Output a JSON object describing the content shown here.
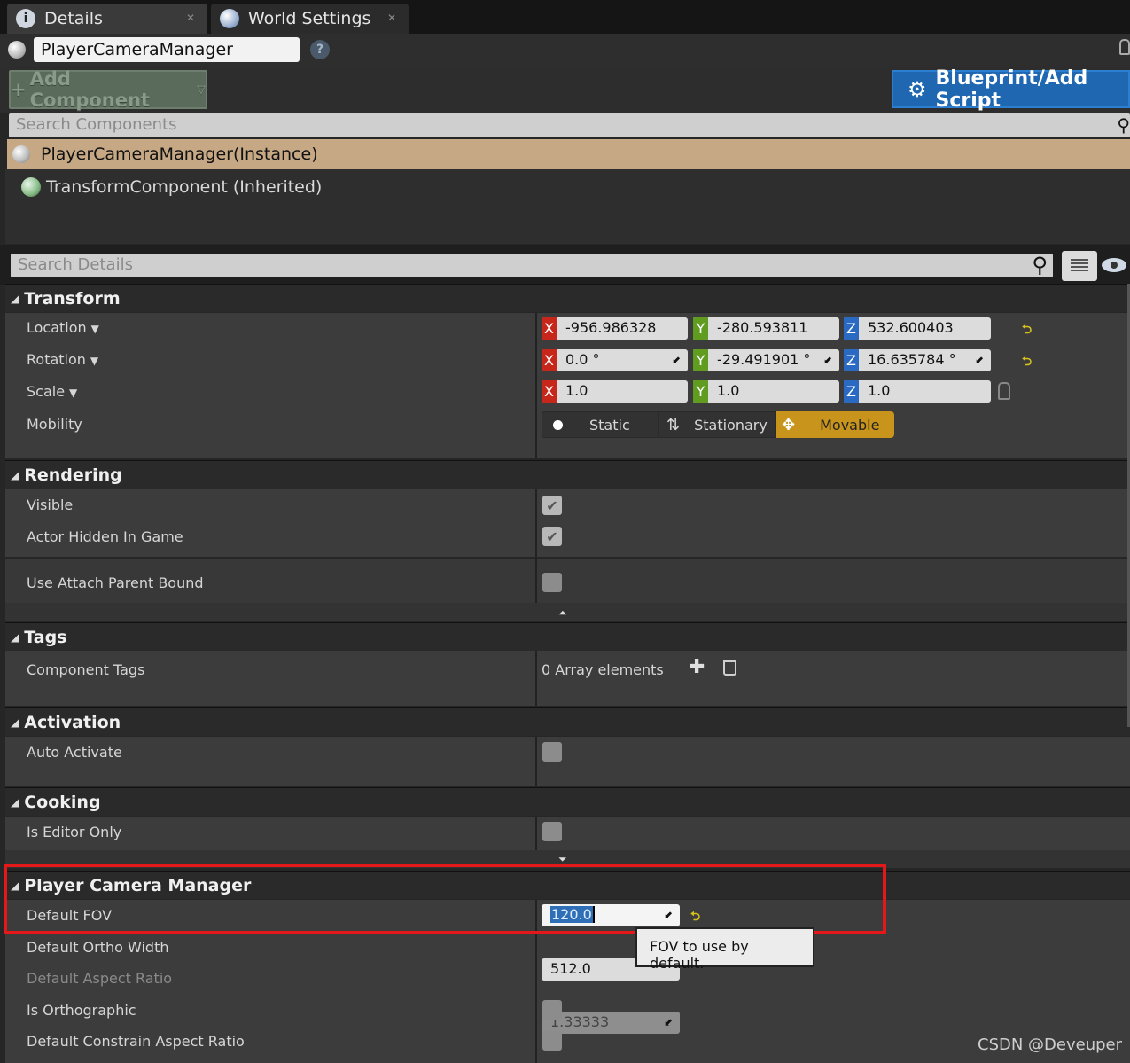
{
  "tabs": [
    {
      "label": "Details",
      "icon": "info-icon",
      "close": "✕"
    },
    {
      "label": "World Settings",
      "icon": "globe-icon",
      "close": "✕"
    }
  ],
  "actor_name": "PlayerCameraManager",
  "help_glyph": "?",
  "add_component_label": "Add Component",
  "blueprint_label": "Blueprint/Add Script",
  "search_components_placeholder": "Search Components",
  "components": {
    "selected": "PlayerCameraManager(Instance)",
    "child": "TransformComponent (Inherited)"
  },
  "search_details_placeholder": "Search Details",
  "categories": {
    "transform": "Transform",
    "rendering": "Rendering",
    "tags": "Tags",
    "activation": "Activation",
    "cooking": "Cooking",
    "pcm": "Player Camera Manager"
  },
  "transform": {
    "location_label": "Location",
    "rotation_label": "Rotation",
    "scale_label": "Scale",
    "mobility_label": "Mobility",
    "axis": {
      "x": "X",
      "y": "Y",
      "z": "Z"
    },
    "location": {
      "x": "-956.986328",
      "y": "-280.593811",
      "z": "532.600403"
    },
    "rotation": {
      "x": "0.0 °",
      "y": "-29.491901 °",
      "z": "16.635784 °"
    },
    "scale": {
      "x": "1.0",
      "y": "1.0",
      "z": "1.0"
    },
    "mobility_options": {
      "static": "Static",
      "stationary": "Stationary",
      "movable": "Movable"
    },
    "mobility_selected": "Movable"
  },
  "rendering": {
    "visible_label": "Visible",
    "visible": true,
    "hidden_label": "Actor Hidden In Game",
    "hidden": true,
    "attach_label": "Use Attach Parent Bound",
    "attach": false
  },
  "tags": {
    "label": "Component Tags",
    "value": "0 Array elements"
  },
  "activation": {
    "label": "Auto Activate",
    "value": false
  },
  "cooking": {
    "label": "Is Editor Only",
    "value": false
  },
  "pcm": {
    "fov_label": "Default FOV",
    "fov_value": "120.0",
    "ortho_label": "Default Ortho Width",
    "ortho_value": "512.0",
    "aspect_label": "Default Aspect Ratio",
    "aspect_value": "1.33333",
    "is_ortho_label": "Is Orthographic",
    "is_ortho": false,
    "constrain_label": "Default Constrain Aspect Ratio",
    "constrain": false
  },
  "tooltip": "FOV to use by default.",
  "watermark": "CSDN @Deveuper",
  "colors": {
    "selected_row": "#c6a885",
    "blueprint_button": "#1f67b1",
    "movable_highlight": "#c9941b",
    "highlight_box": "#e41818"
  }
}
